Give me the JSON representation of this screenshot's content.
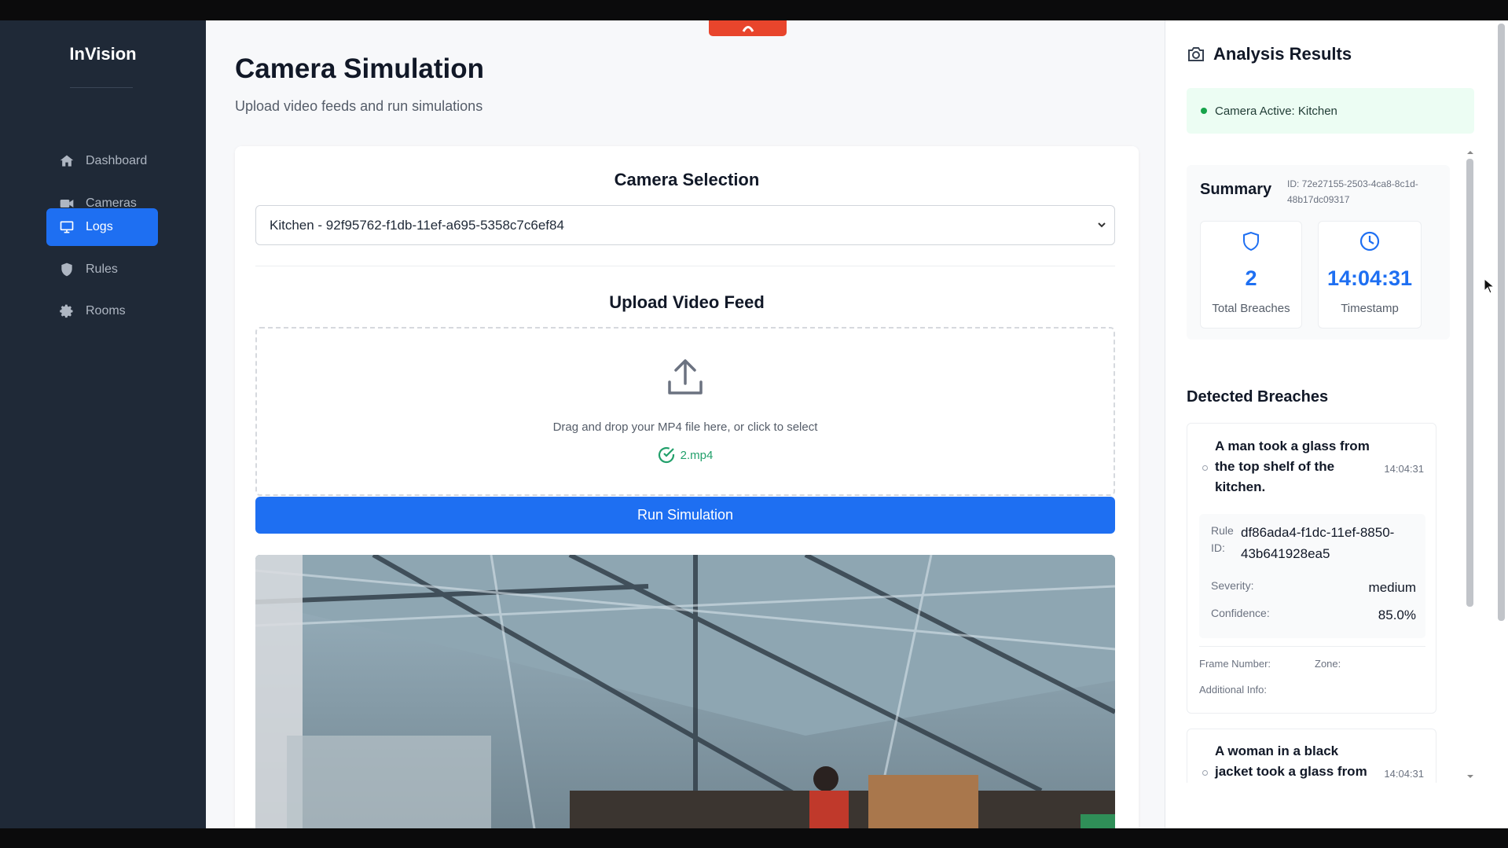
{
  "app": {
    "brand": "InVision"
  },
  "sidebar": {
    "items": [
      {
        "label": "Dashboard",
        "icon": "home-icon",
        "active": false
      },
      {
        "label": "Cameras",
        "icon": "video-camera-icon",
        "active": false
      },
      {
        "label": "Logs",
        "icon": "monitor-icon",
        "active": true
      },
      {
        "label": "Rules",
        "icon": "shield-icon",
        "active": false
      },
      {
        "label": "Rooms",
        "icon": "gear-icon",
        "active": false
      }
    ]
  },
  "main": {
    "title": "Camera Simulation",
    "subtitle": "Upload video feeds and run simulations",
    "camera_selection": {
      "heading": "Camera Selection",
      "selected": "Kitchen - 92f95762-f1db-11ef-a695-5358c7c6ef84"
    },
    "upload": {
      "heading": "Upload Video Feed",
      "instruction": "Drag and drop your MP4 file here, or click to select",
      "file_name": "2.mp4"
    },
    "run_button": "Run Simulation"
  },
  "results": {
    "title": "Analysis Results",
    "camera_status": "Camera Active: Kitchen",
    "summary": {
      "title": "Summary",
      "id": "ID: 72e27155-2503-4ca8-8c1d-48b17dc09317",
      "total_breaches": "2",
      "total_breaches_label": "Total Breaches",
      "timestamp": "14:04:31",
      "timestamp_label": "Timestamp"
    },
    "detected_title": "Detected Breaches",
    "breaches": [
      {
        "text": "A man took a glass from the top shelf of the kitchen.",
        "time": "14:04:31",
        "rule_label": "Rule ID:",
        "rule_id": "df86ada4-f1dc-11ef-8850-43b641928ea5",
        "severity_label": "Severity:",
        "severity": "medium",
        "confidence_label": "Confidence:",
        "confidence": "85.0%",
        "frame_label": "Frame Number:",
        "zone_label": "Zone:",
        "info_label": "Additional Info:"
      },
      {
        "text": "A woman in a black jacket took a glass from the fridge.",
        "time": "14:04:31"
      }
    ]
  },
  "colors": {
    "accent": "#1e6ff2",
    "sidebar": "#1f2937",
    "success": "#22a06b",
    "top_tab": "#e8452c"
  }
}
